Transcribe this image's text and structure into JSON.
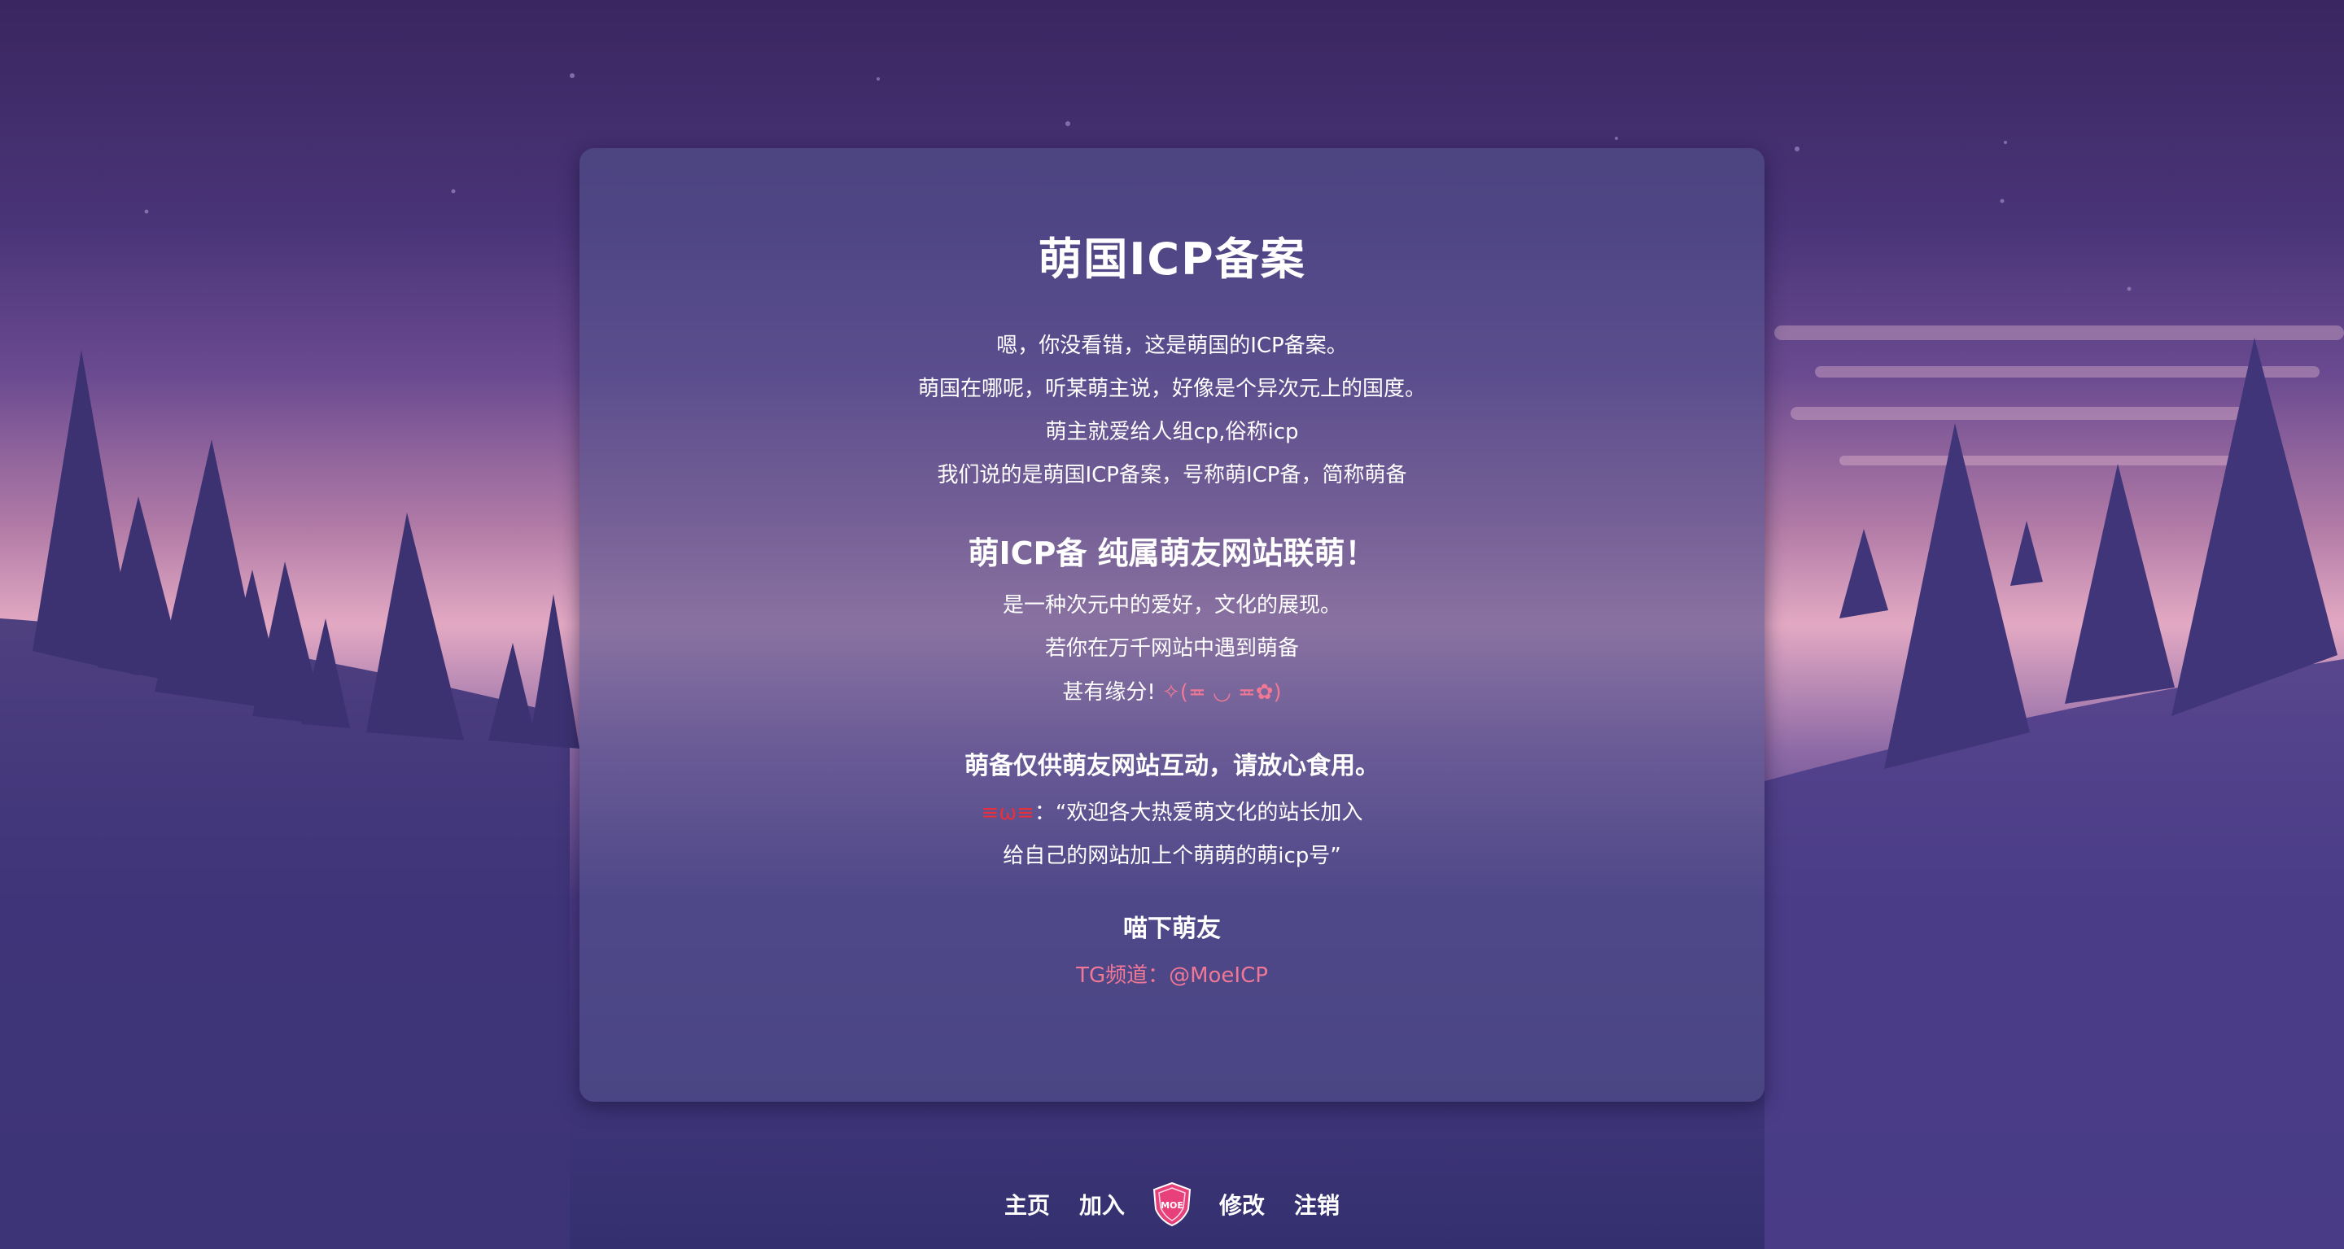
{
  "title": "萌国ICP备案",
  "intro": {
    "line1": "嗯，你没看错，这是萌国的ICP备案。",
    "line2": "萌国在哪呢，听某萌主说，好像是个异次元上的国度。",
    "line3": "萌主就爱给人组cp,俗称icp",
    "line4": "我们说的是萌国ICP备案，号称萌ICP备，简称萌备"
  },
  "section2": {
    "heading": "萌ICP备 纯属萌友网站联萌！",
    "line1": "是一种次元中的爱好，文化的展现。",
    "line2": "若你在万千网站中遇到萌备",
    "line3_prefix": "甚有缘分! ",
    "line3_kaomoji": "✧(≖ ◡ ≖✿)"
  },
  "section3": {
    "heading": "萌备仅供萌友网站互动，请放心食用。",
    "kaomoji": "≡ω≡",
    "quote1": "：“欢迎各大热爱萌文化的站长加入",
    "quote2": "给自己的网站加上个萌萌的萌icp号”"
  },
  "section4": {
    "heading": "喵下萌友",
    "tg_link": "TG频道：@MoeICP"
  },
  "footer": {
    "home": "主页",
    "join": "加入",
    "logo_text": "MOE",
    "edit": "修改",
    "cancel": "注销"
  },
  "colors": {
    "accent_pink": "#f07896",
    "kaomoji_red": "#e8303c",
    "logo_pink": "#e8407a"
  },
  "icons": {
    "logo": "moe-shield-icon"
  }
}
